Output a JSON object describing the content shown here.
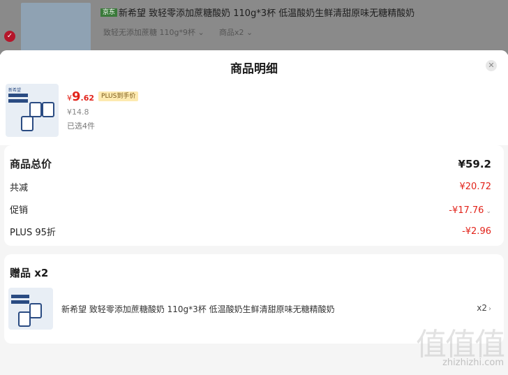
{
  "background_item": {
    "tag": "京东",
    "title": "新希望 致轻零添加蔗糖酸奶 110g*3杯 低温酸奶生鲜清甜原味无糖精酸奶",
    "spec": "致轻无添加蔗糖 110g*9杯 ⌄",
    "qty": "商品x2 ⌄"
  },
  "sheet": {
    "title": "商品明细",
    "close_icon": "close-icon"
  },
  "product": {
    "image_brand": "新希望",
    "image_lines": [
      "0添加蔗糖",
      "简单配方"
    ],
    "currency": "¥",
    "price_int": "9",
    "price_dec": ".62",
    "plus_badge": "PLUS到手价",
    "original_price": "¥14.8",
    "selected": "已选4件"
  },
  "totals": {
    "rows": [
      {
        "label": "商品总价",
        "value": "¥59.2",
        "style": "strong"
      },
      {
        "label": "共减",
        "value": "¥20.72",
        "style": "red"
      },
      {
        "label": "促销",
        "value": "-¥17.76",
        "style": "red",
        "has_chevron": true
      },
      {
        "label": "PLUS 95折",
        "value": "-¥2.96",
        "style": "red"
      }
    ]
  },
  "gifts": {
    "title": "赠品 x2",
    "item": {
      "name": "新希望 致轻零添加蔗糖酸奶 110g*3杯 低温酸奶生鲜清甜原味无糖精酸奶",
      "qty": "x2"
    }
  },
  "watermark": {
    "glyphs": "值值值",
    "domain": "zhizhizhi.com"
  },
  "colors": {
    "accent_red": "#e2231a",
    "plus_badge_bg": "#fdeab0",
    "plus_badge_text": "#7a5a1a"
  }
}
